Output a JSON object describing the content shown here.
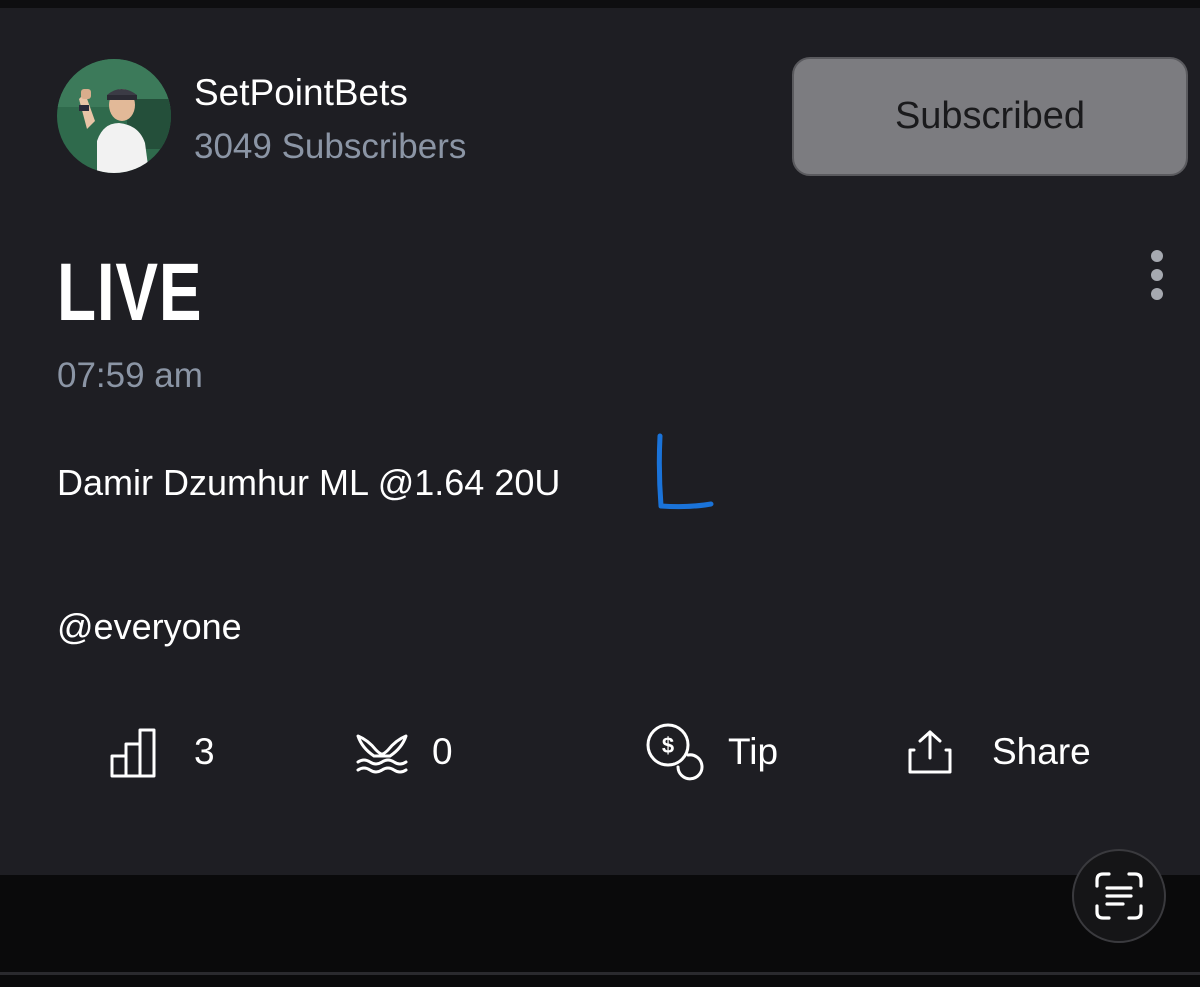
{
  "channel": {
    "name": "SetPointBets",
    "subscribers": "3049 Subscribers",
    "subscribe_label": "Subscribed"
  },
  "post": {
    "title": "LIVE",
    "time": "07:59 am",
    "bet_line": "Damir Dzumhur ML @1.64 20U",
    "result_mark": "L",
    "mention": "@everyone"
  },
  "actions": {
    "views_count": "3",
    "whale_count": "0",
    "tip_label": "Tip",
    "share_label": "Share"
  },
  "icons": {
    "options": "kebab-menu-icon",
    "views": "bar-chart-icon",
    "whale": "whale-tail-icon",
    "tip": "dollar-coin-icon",
    "share": "share-icon",
    "scan": "text-scan-icon"
  },
  "colors": {
    "background": "#1e1e23",
    "subscribe_button": "#7c7c80",
    "secondary_text": "#8b95a5",
    "annotation_blue": "#1a73d9"
  }
}
